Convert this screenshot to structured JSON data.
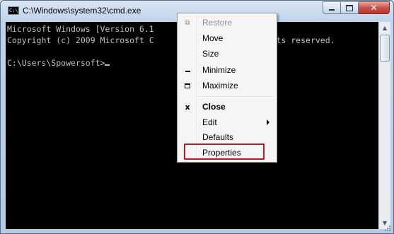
{
  "window": {
    "title": "C:\\Windows\\system32\\cmd.exe",
    "icon": "cmd-icon",
    "icon_text": "C:\\",
    "colors": {
      "console_bg": "#000000",
      "console_text": "#c0c0c0",
      "close_button": "#c75050",
      "highlight": "#b0202a"
    }
  },
  "console": {
    "lines": [
      "Microsoft Windows [Version 6.1",
      "Copyright (c) 2009 Microsoft C",
      "",
      "C:\\Users\\Spowersoft>"
    ],
    "hidden_line_endings": [
      "",
      "ights reserved."
    ]
  },
  "context_menu": {
    "items": [
      {
        "label": "Restore",
        "icon": "restore-icon",
        "disabled": true
      },
      {
        "label": "Move"
      },
      {
        "label": "Size"
      },
      {
        "label": "Minimize",
        "icon": "minimize-icon"
      },
      {
        "label": "Maximize",
        "icon": "maximize-icon"
      },
      {
        "label": "Close",
        "icon": "close-icon",
        "bold": true
      },
      {
        "label": "Edit",
        "has_submenu": true
      },
      {
        "label": "Defaults"
      },
      {
        "label": "Properties",
        "highlighted": true
      }
    ]
  }
}
